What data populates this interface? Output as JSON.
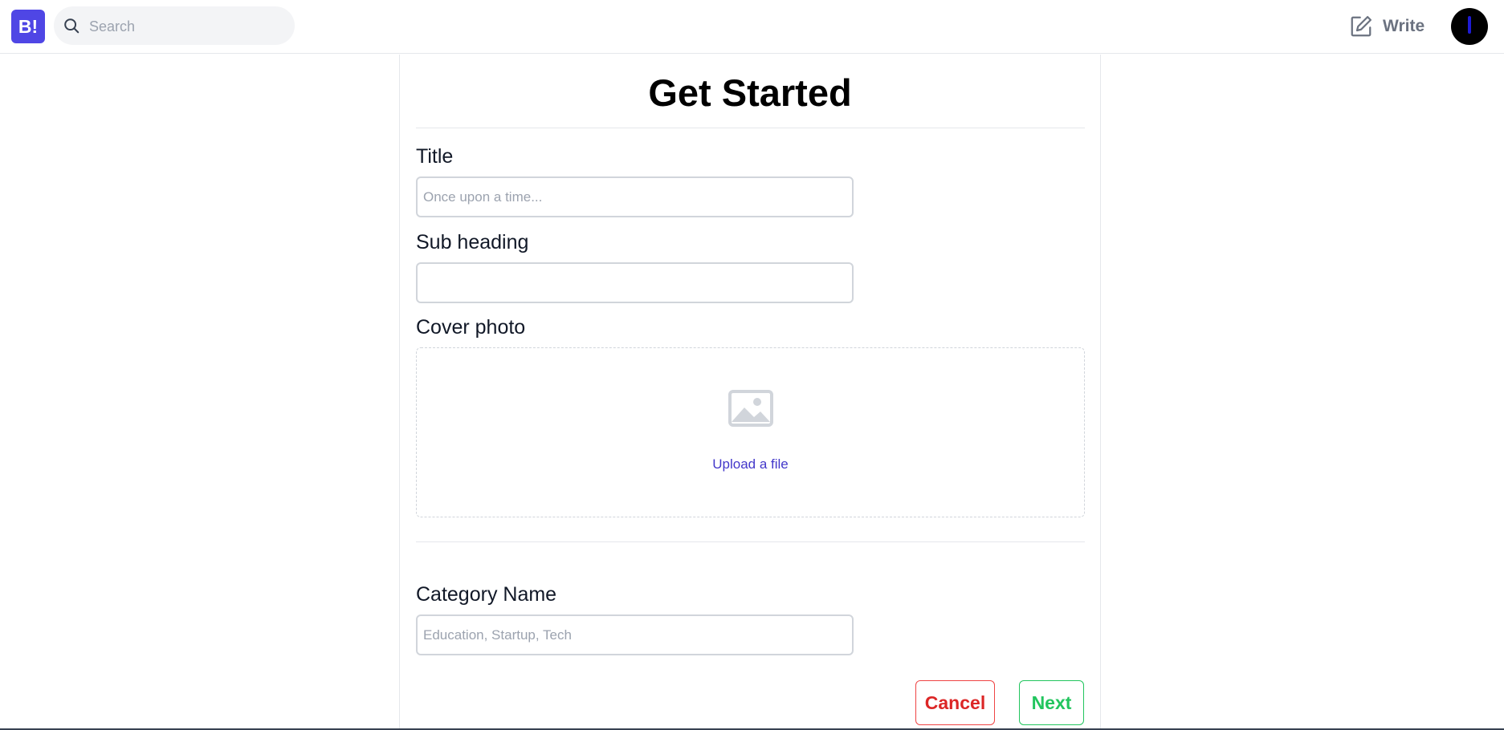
{
  "navbar": {
    "logo_text": "B!",
    "search": {
      "placeholder": "Search",
      "icon": "search-icon"
    },
    "write_label": "Write",
    "write_icon": "edit-square-icon"
  },
  "form": {
    "heading": "Get Started",
    "title": {
      "label": "Title",
      "placeholder": "Once upon a time...",
      "value": ""
    },
    "subheading": {
      "label": "Sub heading",
      "placeholder": "",
      "value": ""
    },
    "cover": {
      "label": "Cover photo",
      "upload_text": "Upload a file",
      "icon": "photo-icon"
    },
    "category": {
      "label": "Category Name",
      "placeholder": "Education, Startup, Tech",
      "value": ""
    },
    "buttons": {
      "cancel": "Cancel",
      "next": "Next"
    }
  },
  "colors": {
    "brand": "#4f46e5",
    "link": "#4338ca",
    "cancel": "#dc2626",
    "next": "#22c55e",
    "muted": "#6b7280"
  }
}
